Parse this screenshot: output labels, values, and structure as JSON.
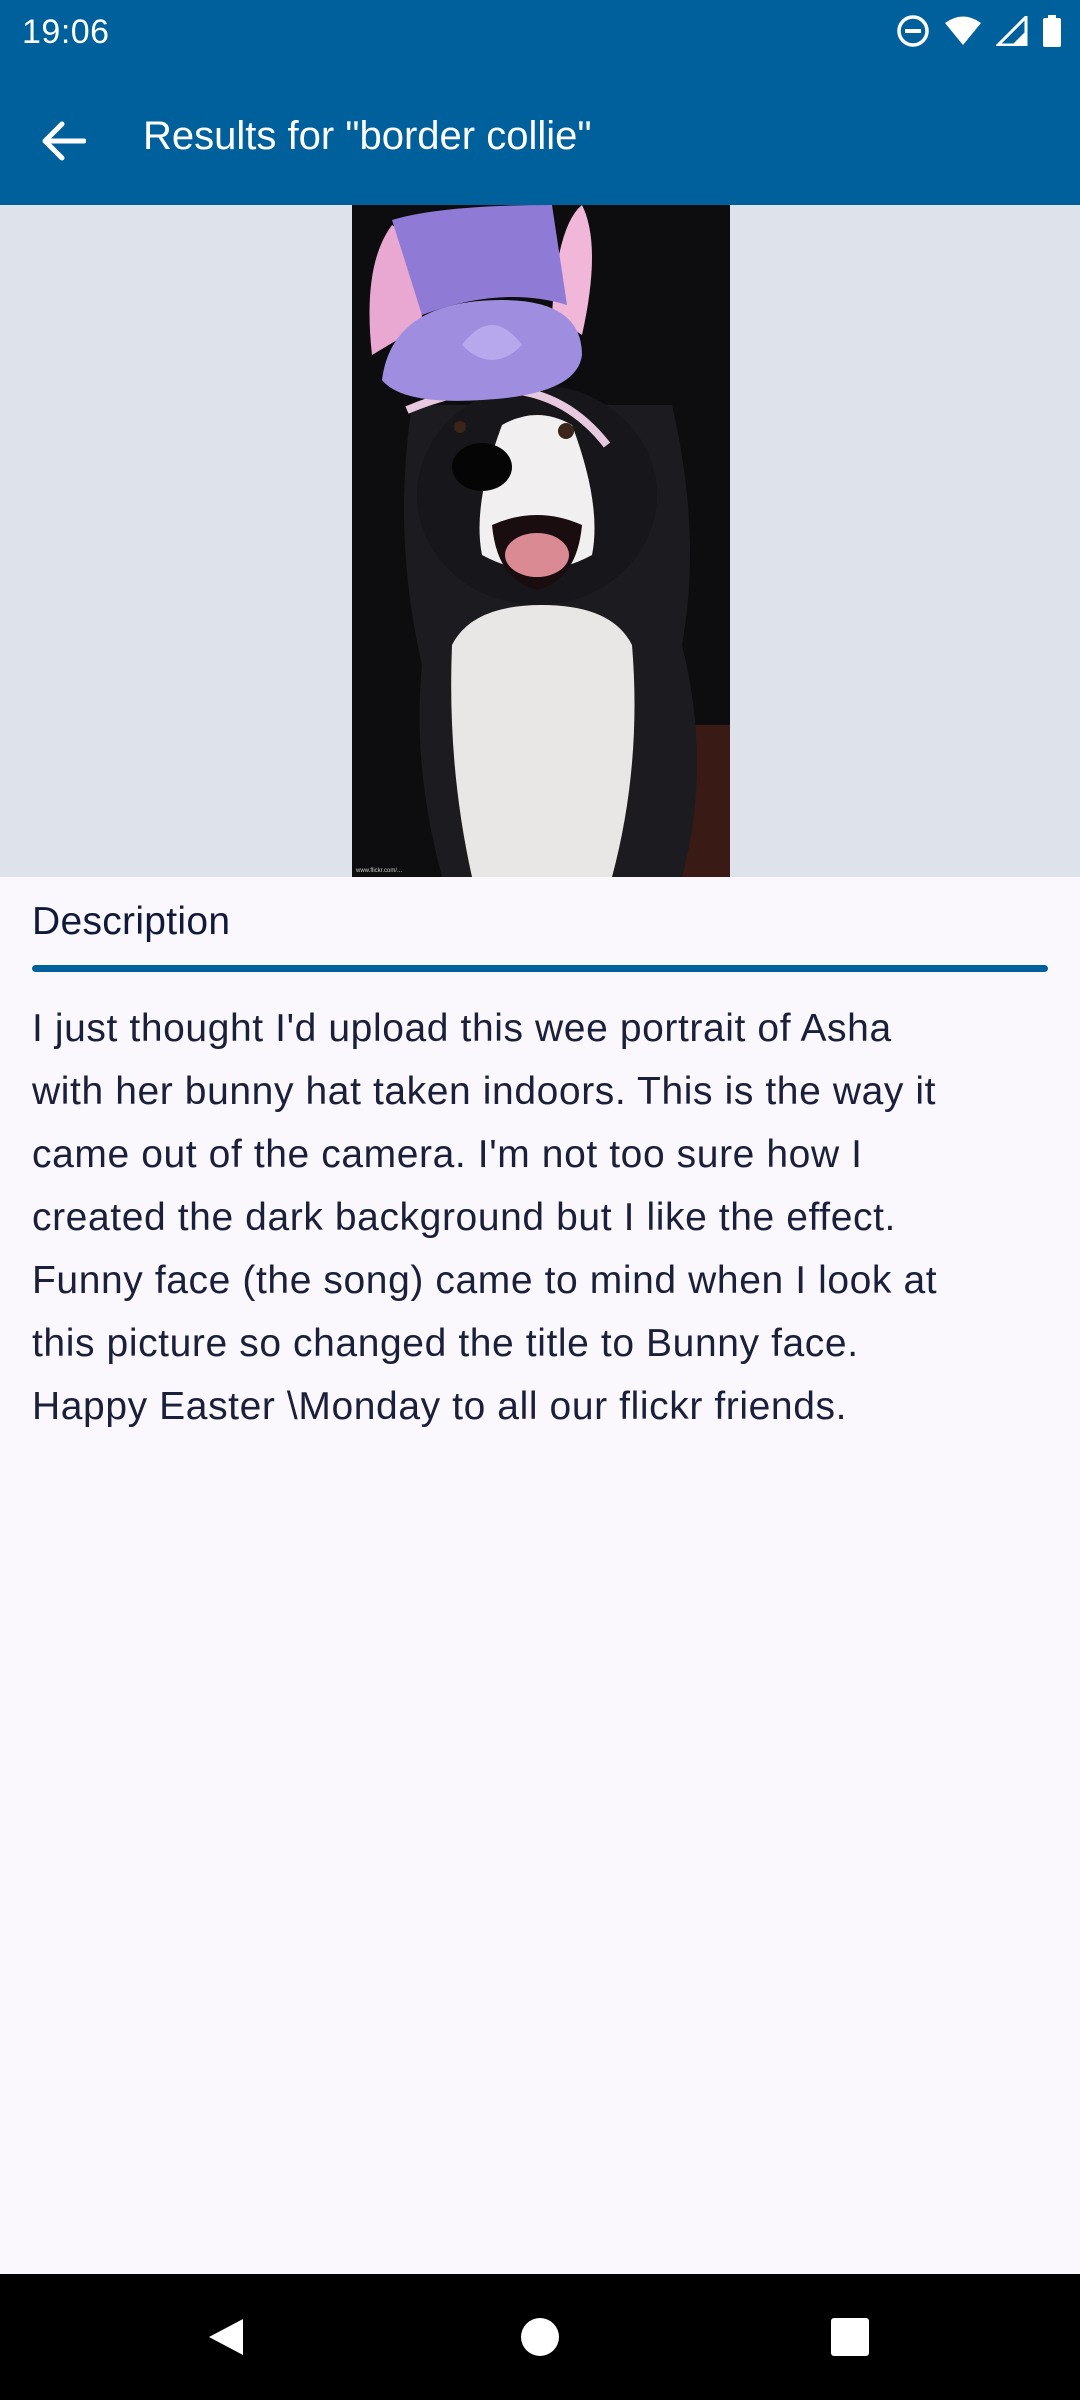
{
  "status_bar": {
    "time": "19:06"
  },
  "app_bar": {
    "title": "Results for \"border collie\"",
    "back_icon": "arrow-back-icon"
  },
  "photo": {
    "subject": "dog-photo",
    "caption_small": "www.flickr.com/..."
  },
  "description": {
    "heading": "Description",
    "body": "I just thought I'd upload this wee portrait of Asha\nwith her bunny hat taken indoors.  This is the way it\ncame out of the camera.  I'm not too sure how I\ncreated the dark background but I like the effect.\nFunny face (the song) came to mind when I look at\nthis picture so changed the title to Bunny face.\nHappy Easter \\Monday to all our flickr friends."
  },
  "colors": {
    "primary": "#00609c",
    "background": "#fbf8fd",
    "image_backdrop": "#dee2ea",
    "text": "#1a1f3a"
  },
  "nav_bar": {
    "back": "nav-back-icon",
    "home": "nav-home-icon",
    "recents": "nav-recents-icon"
  }
}
